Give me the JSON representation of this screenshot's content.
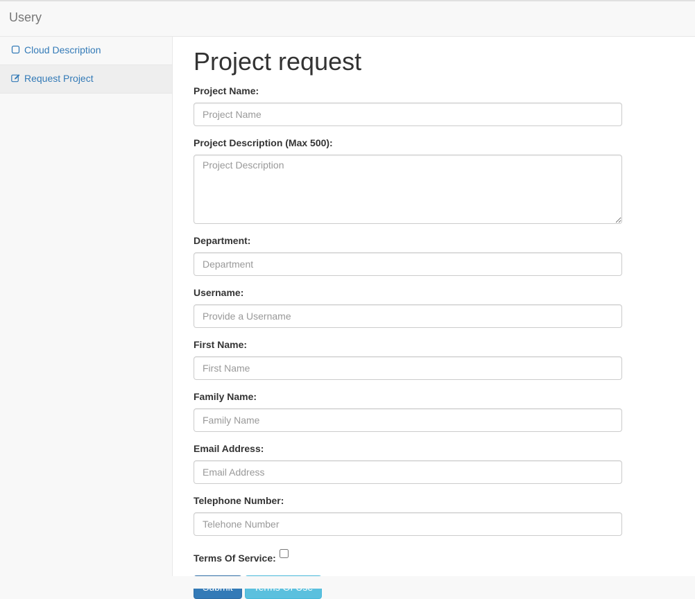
{
  "app": {
    "brand": "Usery"
  },
  "sidebar": {
    "items": [
      {
        "label": "Cloud Description",
        "icon": "square-icon",
        "active": false
      },
      {
        "label": "Request Project",
        "icon": "edit-icon",
        "active": true
      }
    ]
  },
  "page": {
    "title": "Project request"
  },
  "form": {
    "project_name": {
      "label": "Project Name:",
      "placeholder": "Project Name",
      "value": ""
    },
    "project_description": {
      "label": "Project Description (Max 500):",
      "placeholder": "Project Description",
      "value": ""
    },
    "department": {
      "label": "Department:",
      "placeholder": "Department",
      "value": ""
    },
    "username": {
      "label": "Username:",
      "placeholder": "Provide a Username",
      "value": ""
    },
    "first_name": {
      "label": "First Name:",
      "placeholder": "First Name",
      "value": ""
    },
    "family_name": {
      "label": "Family Name:",
      "placeholder": "Family Name",
      "value": ""
    },
    "email": {
      "label": "Email Address:",
      "placeholder": "Email Address",
      "value": ""
    },
    "telephone": {
      "label": "Telephone Number:",
      "placeholder": "Telehone Number",
      "value": ""
    },
    "terms": {
      "label": "Terms Of Service:",
      "checked": false
    },
    "submit_label": "Submit",
    "terms_of_use_label": "Terms Of Use"
  },
  "colors": {
    "link": "#337ab7",
    "primary": "#337ab7",
    "info": "#5bc0de"
  }
}
